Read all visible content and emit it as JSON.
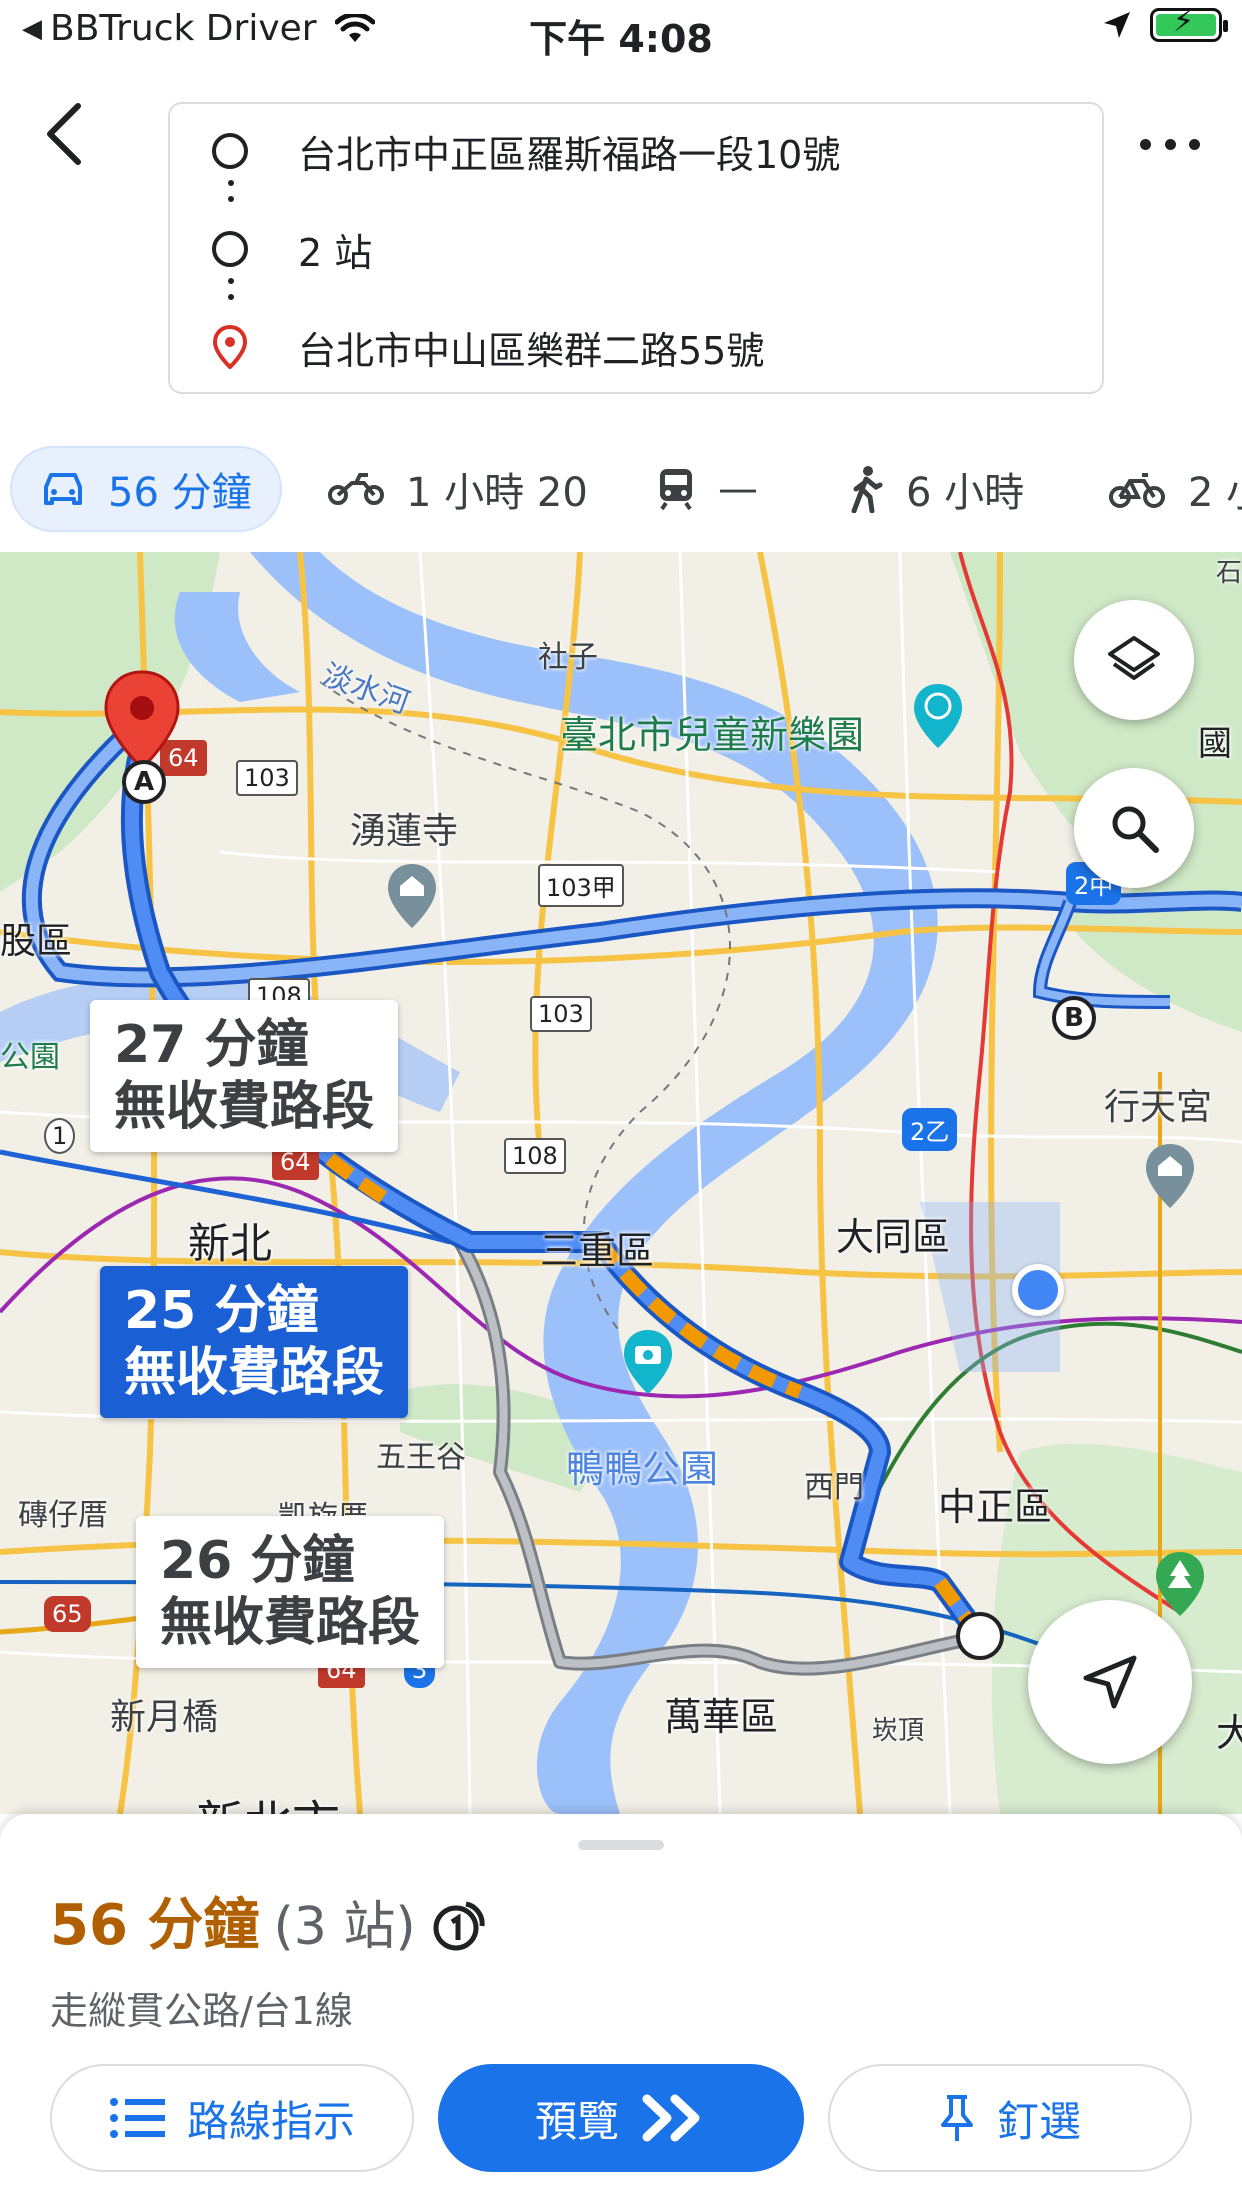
{
  "status_bar": {
    "app": "BBTruck Driver",
    "time": "下午 4:08"
  },
  "route": {
    "origin": "台北市中正區羅斯福路一段10號",
    "waypoints": "2 站",
    "destination": "台北市中山區樂群二路55號"
  },
  "modes": [
    {
      "icon": "car-icon",
      "label": "56 分鐘"
    },
    {
      "icon": "motorcycle-icon",
      "label": "1 小時 20"
    },
    {
      "icon": "transit-icon",
      "label": "—"
    },
    {
      "icon": "walk-icon",
      "label": "6 小時"
    },
    {
      "icon": "bike-icon",
      "label": "2 小"
    }
  ],
  "map": {
    "labels": {
      "shezi": "社子",
      "tamsui_river": "淡水河",
      "childrens_park": "臺北市兒童新樂園",
      "yonglian_temple": "湧蓮寺",
      "beitou_partial": "股區",
      "park_partial": "公園",
      "xinbei": "新北",
      "sanchong": "三重區",
      "datong": "大同區",
      "xingtian_temple": "行天宮",
      "wugu": "五王谷",
      "duck_park": "鴨鴨公園",
      "ximen": "西門",
      "zhongzheng": "中正區",
      "zhuanzaicuo": "磚仔厝",
      "jiuxianchuang": "凱旋厝",
      "xinyue_bridge": "新月橋",
      "wanhua": "萬華區",
      "kanding": "崁頂",
      "country_partial": "國",
      "shi_partial": "石",
      "xinbei_city_partial": "新北市",
      "da_partial": "大"
    },
    "shields": [
      "103",
      "103甲",
      "103",
      "108",
      "108",
      "64",
      "64",
      "2乙",
      "65",
      "3",
      "1",
      "2中",
      "64"
    ],
    "callouts": [
      {
        "minutes": "27 分鐘",
        "note": "無收費路段"
      },
      {
        "minutes": "25 分鐘",
        "note": "無收費路段"
      },
      {
        "minutes": "26 分鐘",
        "note": "無收費路段"
      }
    ],
    "marker_a": "A",
    "marker_b": "B"
  },
  "sheet": {
    "duration": "56 分鐘",
    "stops": "(3 站)",
    "via": "走縱貫公路/台1線",
    "buttons": {
      "steps": "路線指示",
      "preview": "預覽",
      "pin": "釘選"
    }
  },
  "colors": {
    "accent": "#1a73e8",
    "duration": "#b06000",
    "route_main": "#4285f4",
    "route_alt": "#9aa0a6",
    "traffic": "#f29900"
  }
}
